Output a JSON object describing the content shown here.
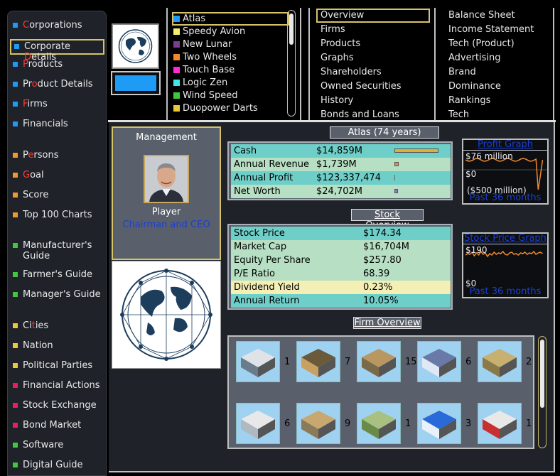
{
  "sidebar": {
    "items": [
      {
        "pre": "",
        "hl": "C",
        "post": "orporations",
        "color": "#1e9bf5"
      },
      {
        "pre": "Corporate ",
        "hl": "D",
        "post": "etails",
        "color": "#1e9bf5",
        "selected": true
      },
      {
        "pre": "",
        "hl": "P",
        "post": "roducts",
        "color": "#1e9bf5"
      },
      {
        "pre": "Pr",
        "hl": "o",
        "post": "duct Details",
        "color": "#1e9bf5"
      },
      {
        "pre": "",
        "hl": "F",
        "post": "irms",
        "color": "#1e9bf5"
      },
      {
        "pre": "Financials",
        "hl": "",
        "post": "",
        "color": "#1e9bf5"
      },
      {
        "pre": "P",
        "hl": "e",
        "post": "rsons",
        "color": "#f0982c"
      },
      {
        "pre": "",
        "hl": "G",
        "post": "oal",
        "color": "#f0982c"
      },
      {
        "pre": "Score",
        "hl": "",
        "post": "",
        "color": "#f0982c"
      },
      {
        "pre": "Top 100 Charts",
        "hl": "",
        "post": "",
        "color": "#f0982c"
      },
      {
        "pre": "Manufacturer's Guide",
        "hl": "",
        "post": "",
        "color": "#3ec83e"
      },
      {
        "pre": "Farmer's Guide",
        "hl": "",
        "post": "",
        "color": "#3ec83e"
      },
      {
        "pre": "Manager's Guide",
        "hl": "",
        "post": "",
        "color": "#3ec83e"
      },
      {
        "pre": "Ci",
        "hl": "t",
        "post": "ies",
        "color": "#e8c93a"
      },
      {
        "pre": "Nation",
        "hl": "",
        "post": "",
        "color": "#e8c93a"
      },
      {
        "pre": "Political Parties",
        "hl": "",
        "post": "",
        "color": "#e8c93a"
      },
      {
        "pre": "Financial Actions",
        "hl": "",
        "post": "",
        "color": "#e8205a"
      },
      {
        "pre": "Stock Exchange",
        "hl": "",
        "post": "",
        "color": "#e8205a"
      },
      {
        "pre": "Bond Market",
        "hl": "",
        "post": "",
        "color": "#e8205a"
      },
      {
        "pre": "Software",
        "hl": "",
        "post": "",
        "color": "#3ec83e"
      },
      {
        "pre": "Digital Guide",
        "hl": "",
        "post": "",
        "color": "#3ec83e"
      }
    ]
  },
  "firms_list": [
    {
      "name": "Atlas",
      "color": "#1e9bf5",
      "selected": true
    },
    {
      "name": "Speedy Avion",
      "color": "#f4f06a"
    },
    {
      "name": "New Lunar",
      "color": "#7a3e8a"
    },
    {
      "name": "Two Wheels",
      "color": "#f08a2c"
    },
    {
      "name": "Touch Base",
      "color": "#ff2ad4"
    },
    {
      "name": "Logic Zen",
      "color": "#3ee8e8"
    },
    {
      "name": "Wind Speed",
      "color": "#3ec83e"
    },
    {
      "name": "Duopower Darts",
      "color": "#e8c93a"
    }
  ],
  "nav": [
    "Overview",
    "Firms",
    "Products",
    "Graphs",
    "Shareholders",
    "Owned Securities",
    "History",
    "Bonds and Loans"
  ],
  "reports": [
    "Balance Sheet",
    "Income Statement",
    "Tech (Product)",
    "Advertising",
    "Brand",
    "Dominance",
    "Rankings",
    "Tech"
  ],
  "management": {
    "title": "Management",
    "name": "Player",
    "role": "Chairman and CEO"
  },
  "company_label": "Atlas (74 years)",
  "summary_rows": [
    {
      "k": "Cash",
      "v": "$14,859M",
      "bar": 1.0,
      "bar_color": "#d9b23a"
    },
    {
      "k": "Annual Revenue",
      "v": "$1,739M",
      "bar": 0.1,
      "bar_color": "#f08a2c"
    },
    {
      "k": "Annual Profit",
      "v": "$123,337,474",
      "bar": 0.0,
      "bar_color": "#2a2a2a"
    },
    {
      "k": "Net Worth",
      "v": "$24,702M",
      "bar": 0.08,
      "bar_color": "#8a7ad8"
    }
  ],
  "profit_graph": {
    "title": "Profit Graph",
    "max": "$76 million",
    "zero": "$0",
    "min": "($500 million)",
    "foot": "Past 36 months"
  },
  "stock_overview_label": "Stock Overview",
  "stock_rows": [
    {
      "k": "Stock Price",
      "v": "$174.34"
    },
    {
      "k": "Market Cap",
      "v": "$16,704M"
    },
    {
      "k": "Equity Per Share",
      "v": "$257.80"
    },
    {
      "k": "P/E Ratio",
      "v": "68.39"
    },
    {
      "k": "Dividend Yield",
      "v": "0.23%"
    },
    {
      "k": "Annual Return",
      "v": "10.05%"
    }
  ],
  "stock_graph": {
    "title": "Stock Price Graph",
    "max": "$190",
    "zero": "$0",
    "foot": "Past 36 months"
  },
  "firm_overview_label": "Firm Overview",
  "firm_counts": [
    "1",
    "7",
    "15",
    "6",
    "2",
    "6",
    "9",
    "1",
    "3",
    "1"
  ],
  "firm_icons": [
    "factory-icon",
    "retail-store-icon",
    "mine-icon",
    "office-building-icon",
    "farm-icon",
    "warehouse-icon",
    "mine-quarry-icon",
    "farm-field-icon",
    "hospital-icon",
    "fire-station-icon"
  ]
}
